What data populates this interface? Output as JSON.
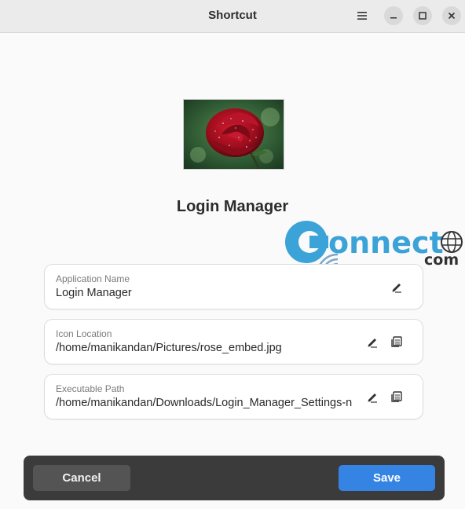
{
  "window": {
    "title": "Shortcut"
  },
  "app": {
    "name": "Login Manager",
    "image_icon": "rose-photo"
  },
  "fields": [
    {
      "label": "Application Name",
      "value": "Login Manager"
    },
    {
      "label": "Icon Location",
      "value": "/home/manikandan/Pictures/rose_embed.jpg"
    },
    {
      "label": "Executable Path",
      "value": "/home/manikandan/Downloads/Login_Manager_Settings-n"
    }
  ],
  "footer": {
    "cancel_label": "Cancel",
    "save_label": "Save"
  },
  "watermark": {
    "text": "onnect",
    "sub": "com"
  },
  "colors": {
    "accent": "#3584e4",
    "footer_bg": "#3b3b3b",
    "watermark": "#3ba3d8"
  }
}
